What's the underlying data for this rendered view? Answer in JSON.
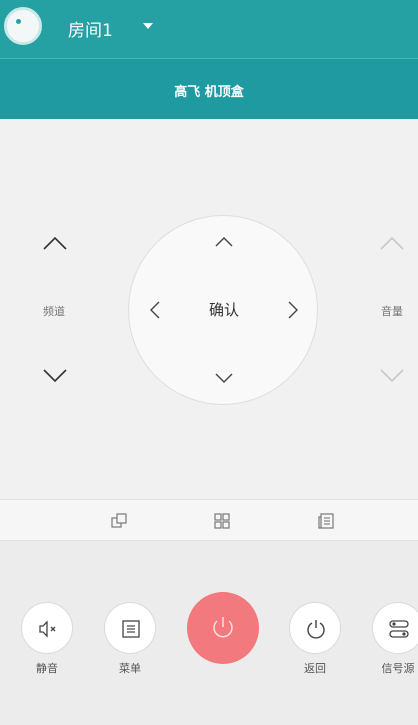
{
  "header": {
    "room_name": "房间1"
  },
  "device": {
    "name": "高飞 机顶盒"
  },
  "remote": {
    "channel_label": "频道",
    "volume_label": "音量",
    "ok_label": "确认"
  },
  "bottom": {
    "mute_label": "静音",
    "menu_label": "菜单",
    "back_label": "返回",
    "source_label": "信号源"
  },
  "colors": {
    "accent": "#25a1a4",
    "power": "#f2797d",
    "background": "#f1f1f1"
  }
}
